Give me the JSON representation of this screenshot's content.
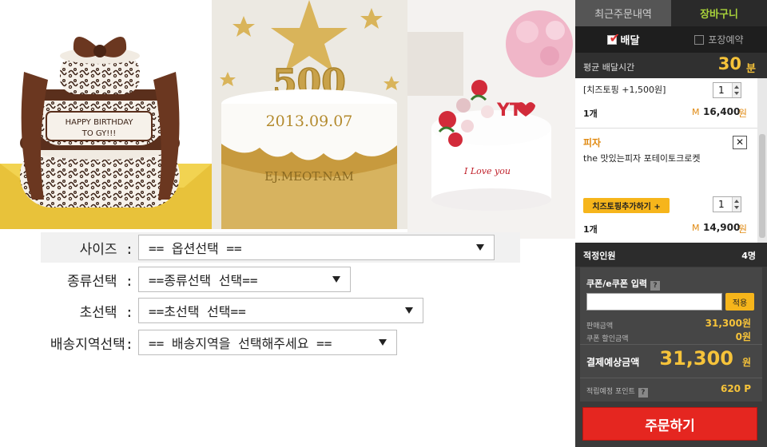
{
  "photos": [
    {
      "name": "chocolate-birthday-cake",
      "text_lines": [
        "HAPPY BIRTHDAY",
        "TO GY!!!"
      ]
    },
    {
      "name": "gold-star-500-cake",
      "big_number": "500",
      "text_lines": [
        "2013.09.07",
        "EJ.MEOT-NAM"
      ]
    },
    {
      "name": "rose-love-cake",
      "text_top": "YT",
      "text_lines": [
        "I Love you"
      ]
    }
  ],
  "form": {
    "size": {
      "label": "사이즈 :",
      "value": "== 옵션선택 =="
    },
    "type": {
      "label": "종류선택 :",
      "value": "==종류선택 선택=="
    },
    "candle": {
      "label": "초선택 :",
      "value": "==초선택 선택=="
    },
    "region": {
      "label": "배송지역선택:",
      "value": "== 배송지역을 선택해주세요 =="
    }
  },
  "panel": {
    "tabs": {
      "recent": "최근주문내역",
      "cart": "장바구니"
    },
    "delivery": {
      "deliver": "배달",
      "takeout": "포장예약"
    },
    "avg_time": {
      "label": "평균 배달시간",
      "value": "30",
      "unit": "분"
    },
    "items": [
      {
        "option": "[치즈토핑 +1,500원]",
        "qty": "1",
        "count": "1개",
        "currency": "M",
        "price": "16,400",
        "won": "원"
      },
      {
        "name": "피자",
        "desc": "the 맛있는피자 포테이토크로켓",
        "topping_button": "치즈토핑추가하기 +",
        "qty": "1",
        "count": "1개",
        "currency": "M",
        "price": "14,900",
        "won": "원",
        "close": "✕"
      }
    ],
    "people": {
      "label": "적정인원",
      "value": "4명"
    },
    "coupon": {
      "label": "쿠폰/e쿠폰 입력",
      "help": "?",
      "input_value": "",
      "apply": "적용"
    },
    "summary": {
      "sale_label": "판매금액",
      "sale_value": "31,300원",
      "discount_label": "쿠폰 할인금액",
      "discount_value": "0원",
      "total_label": "결제예상금액",
      "total_value": "31,300",
      "total_unit": "원",
      "point_label": "적립예정 포인트",
      "point_help": "?",
      "point_value": "620 P"
    },
    "order_button": "주문하기"
  },
  "colors": {
    "panel_bg": "#3a3a3a",
    "accent_yellow": "#f6c33a",
    "accent_orange": "#e08a12",
    "tab_active": "#a8d23a",
    "order_red": "#e52620"
  }
}
